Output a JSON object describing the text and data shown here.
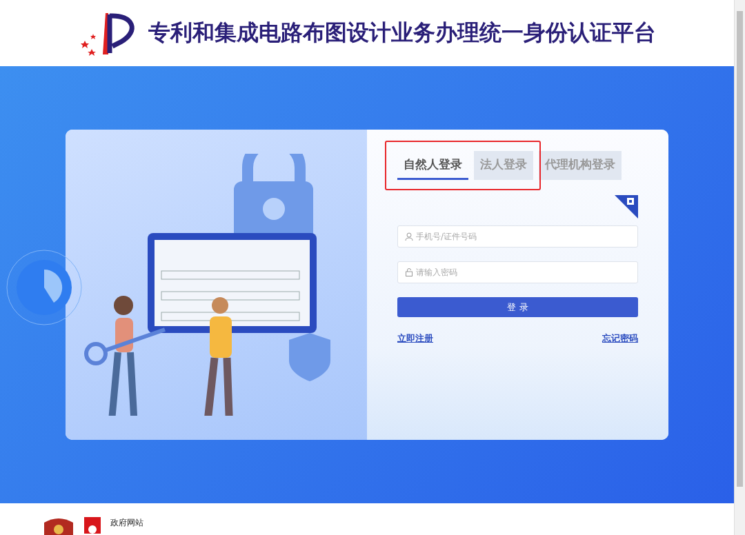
{
  "header": {
    "title": "专利和集成电路布图设计业务办理统一身份认证平台"
  },
  "login": {
    "tabs": [
      {
        "label": "自然人登录",
        "selected": true,
        "highlighted": true
      },
      {
        "label": "法人登录",
        "selected": false,
        "highlighted": true
      },
      {
        "label": "代理机构登录",
        "selected": false,
        "highlighted": false
      }
    ],
    "username": {
      "placeholder": "手机号/证件号码"
    },
    "password": {
      "placeholder": "请输入密码"
    },
    "submit": "登 录",
    "links": [
      "立即注册",
      "忘记密码"
    ]
  },
  "footer": {
    "gov_site": "政府网站"
  }
}
